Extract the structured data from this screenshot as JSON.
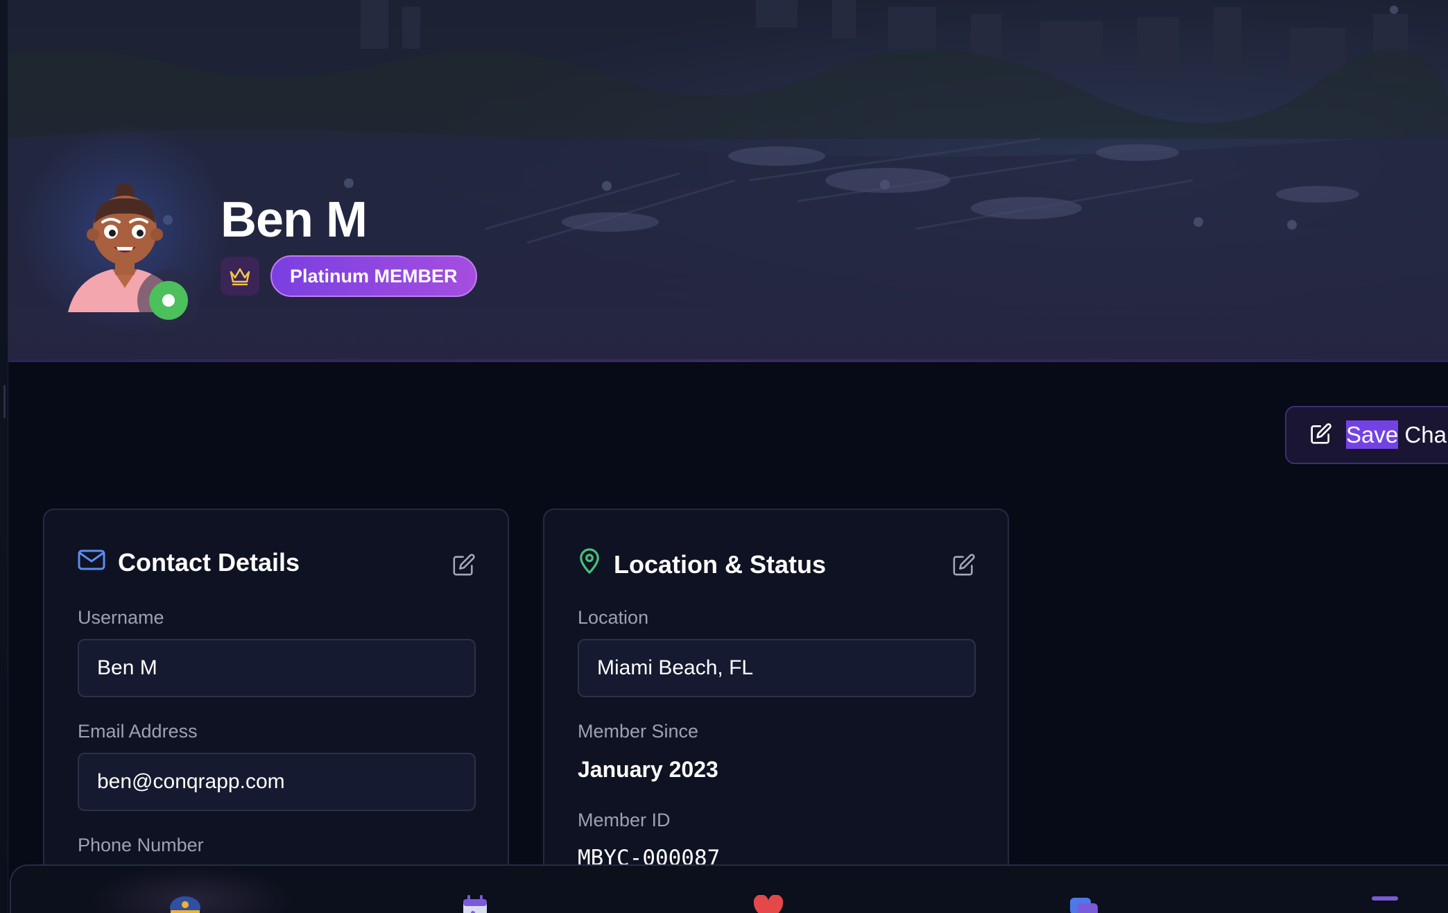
{
  "profile": {
    "name": "Ben M",
    "tier": "Platinum MEMBER",
    "status": "online"
  },
  "actions": {
    "save_highlight": "Save",
    "save_rest": " Chan"
  },
  "contact": {
    "title": "Contact Details",
    "username_label": "Username",
    "username_value": "Ben M",
    "email_label": "Email Address",
    "email_value": "ben@conqrapp.com",
    "phone_label": "Phone Number"
  },
  "location": {
    "title": "Location & Status",
    "location_label": "Location",
    "location_value": "Miami Beach, FL",
    "member_since_label": "Member Since",
    "member_since_value": "January 2023",
    "member_id_label": "Member ID",
    "member_id_value": "MBYC-000087"
  },
  "icons": {
    "tier": "crown-icon",
    "save": "edit-icon",
    "contact": "mail-icon",
    "location": "map-pin-icon",
    "card_edit": "edit-icon",
    "nav": [
      "captain-hat-icon",
      "calendar-icon",
      "heart-icon",
      "chat-icon",
      "more-icon"
    ]
  },
  "colors": {
    "background": "#070a17",
    "card": "#0f1222",
    "accent_purple": "#7a3fe0",
    "online_green": "#4cc05a",
    "mail_icon_blue": "#5b8def",
    "pin_icon_green": "#45c07a"
  }
}
